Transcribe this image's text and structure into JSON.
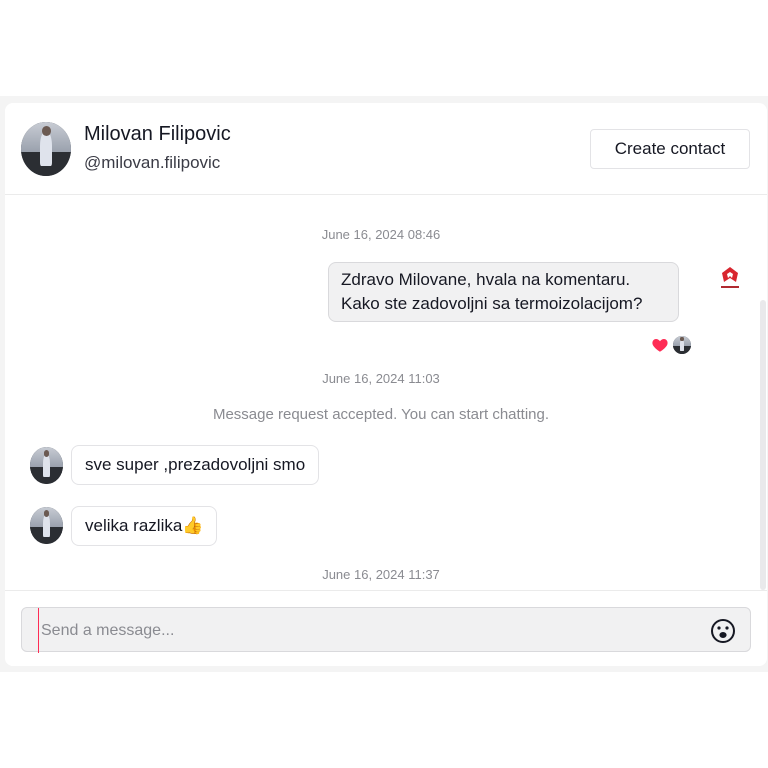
{
  "header": {
    "name": "Milovan Filipovic",
    "handle": "@milovan.filipovic",
    "create_contact_label": "Create contact"
  },
  "messages": {
    "timestamps": [
      "June 16, 2024 08:46",
      "June 16, 2024 11:03",
      "June 16, 2024 11:37"
    ],
    "outgoing": [
      {
        "text": "Zdravo Milovane, hvala na komentaru. Kako ste zadovoljni sa termoizolacijom?"
      }
    ],
    "system_notice": "Message request accepted. You can start chatting.",
    "incoming": [
      {
        "text": "sve super ,prezadovoljni smo"
      },
      {
        "text": "velika razlika👍"
      }
    ]
  },
  "composer": {
    "placeholder": "Send a message..."
  },
  "colors": {
    "accent_cursor": "#fe2c55",
    "heart": "#fe2c55",
    "bubble_out_bg": "#f1f1f2"
  },
  "icons": [
    "heart-icon",
    "emoji-icon",
    "brand-logo"
  ]
}
